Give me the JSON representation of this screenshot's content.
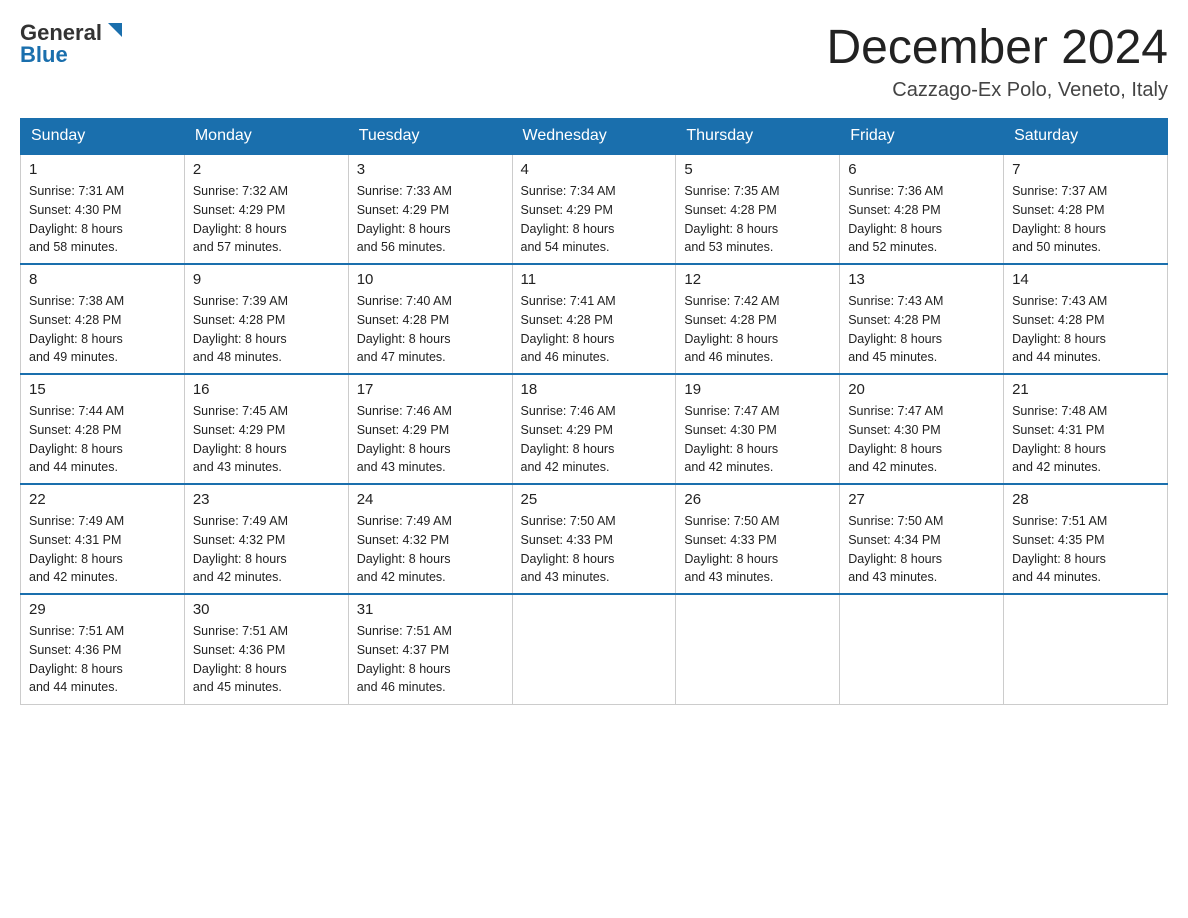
{
  "header": {
    "logo_general": "General",
    "logo_blue": "Blue",
    "month_title": "December 2024",
    "location": "Cazzago-Ex Polo, Veneto, Italy"
  },
  "weekdays": [
    "Sunday",
    "Monday",
    "Tuesday",
    "Wednesday",
    "Thursday",
    "Friday",
    "Saturday"
  ],
  "weeks": [
    [
      {
        "day": "1",
        "sunrise": "7:31 AM",
        "sunset": "4:30 PM",
        "daylight": "8 hours and 58 minutes."
      },
      {
        "day": "2",
        "sunrise": "7:32 AM",
        "sunset": "4:29 PM",
        "daylight": "8 hours and 57 minutes."
      },
      {
        "day": "3",
        "sunrise": "7:33 AM",
        "sunset": "4:29 PM",
        "daylight": "8 hours and 56 minutes."
      },
      {
        "day": "4",
        "sunrise": "7:34 AM",
        "sunset": "4:29 PM",
        "daylight": "8 hours and 54 minutes."
      },
      {
        "day": "5",
        "sunrise": "7:35 AM",
        "sunset": "4:28 PM",
        "daylight": "8 hours and 53 minutes."
      },
      {
        "day": "6",
        "sunrise": "7:36 AM",
        "sunset": "4:28 PM",
        "daylight": "8 hours and 52 minutes."
      },
      {
        "day": "7",
        "sunrise": "7:37 AM",
        "sunset": "4:28 PM",
        "daylight": "8 hours and 50 minutes."
      }
    ],
    [
      {
        "day": "8",
        "sunrise": "7:38 AM",
        "sunset": "4:28 PM",
        "daylight": "8 hours and 49 minutes."
      },
      {
        "day": "9",
        "sunrise": "7:39 AM",
        "sunset": "4:28 PM",
        "daylight": "8 hours and 48 minutes."
      },
      {
        "day": "10",
        "sunrise": "7:40 AM",
        "sunset": "4:28 PM",
        "daylight": "8 hours and 47 minutes."
      },
      {
        "day": "11",
        "sunrise": "7:41 AM",
        "sunset": "4:28 PM",
        "daylight": "8 hours and 46 minutes."
      },
      {
        "day": "12",
        "sunrise": "7:42 AM",
        "sunset": "4:28 PM",
        "daylight": "8 hours and 46 minutes."
      },
      {
        "day": "13",
        "sunrise": "7:43 AM",
        "sunset": "4:28 PM",
        "daylight": "8 hours and 45 minutes."
      },
      {
        "day": "14",
        "sunrise": "7:43 AM",
        "sunset": "4:28 PM",
        "daylight": "8 hours and 44 minutes."
      }
    ],
    [
      {
        "day": "15",
        "sunrise": "7:44 AM",
        "sunset": "4:28 PM",
        "daylight": "8 hours and 44 minutes."
      },
      {
        "day": "16",
        "sunrise": "7:45 AM",
        "sunset": "4:29 PM",
        "daylight": "8 hours and 43 minutes."
      },
      {
        "day": "17",
        "sunrise": "7:46 AM",
        "sunset": "4:29 PM",
        "daylight": "8 hours and 43 minutes."
      },
      {
        "day": "18",
        "sunrise": "7:46 AM",
        "sunset": "4:29 PM",
        "daylight": "8 hours and 42 minutes."
      },
      {
        "day": "19",
        "sunrise": "7:47 AM",
        "sunset": "4:30 PM",
        "daylight": "8 hours and 42 minutes."
      },
      {
        "day": "20",
        "sunrise": "7:47 AM",
        "sunset": "4:30 PM",
        "daylight": "8 hours and 42 minutes."
      },
      {
        "day": "21",
        "sunrise": "7:48 AM",
        "sunset": "4:31 PM",
        "daylight": "8 hours and 42 minutes."
      }
    ],
    [
      {
        "day": "22",
        "sunrise": "7:49 AM",
        "sunset": "4:31 PM",
        "daylight": "8 hours and 42 minutes."
      },
      {
        "day": "23",
        "sunrise": "7:49 AM",
        "sunset": "4:32 PM",
        "daylight": "8 hours and 42 minutes."
      },
      {
        "day": "24",
        "sunrise": "7:49 AM",
        "sunset": "4:32 PM",
        "daylight": "8 hours and 42 minutes."
      },
      {
        "day": "25",
        "sunrise": "7:50 AM",
        "sunset": "4:33 PM",
        "daylight": "8 hours and 43 minutes."
      },
      {
        "day": "26",
        "sunrise": "7:50 AM",
        "sunset": "4:33 PM",
        "daylight": "8 hours and 43 minutes."
      },
      {
        "day": "27",
        "sunrise": "7:50 AM",
        "sunset": "4:34 PM",
        "daylight": "8 hours and 43 minutes."
      },
      {
        "day": "28",
        "sunrise": "7:51 AM",
        "sunset": "4:35 PM",
        "daylight": "8 hours and 44 minutes."
      }
    ],
    [
      {
        "day": "29",
        "sunrise": "7:51 AM",
        "sunset": "4:36 PM",
        "daylight": "8 hours and 44 minutes."
      },
      {
        "day": "30",
        "sunrise": "7:51 AM",
        "sunset": "4:36 PM",
        "daylight": "8 hours and 45 minutes."
      },
      {
        "day": "31",
        "sunrise": "7:51 AM",
        "sunset": "4:37 PM",
        "daylight": "8 hours and 46 minutes."
      },
      null,
      null,
      null,
      null
    ]
  ]
}
